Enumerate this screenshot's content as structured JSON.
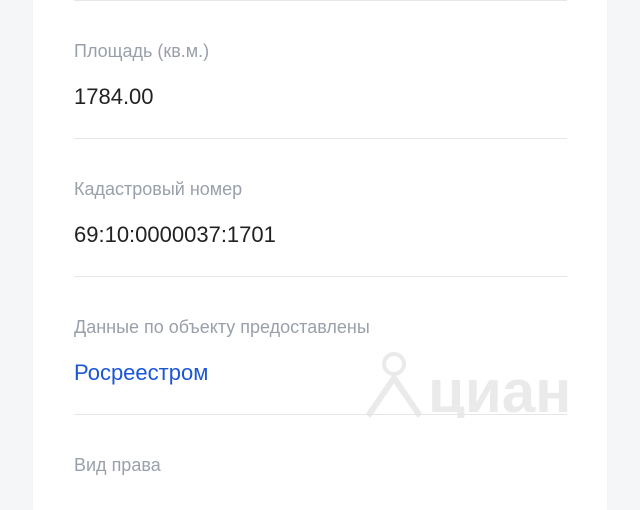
{
  "fields": [
    {
      "label": "Площадь (кв.м.)",
      "value": "1784.00"
    },
    {
      "label": "Кадастровый номер",
      "value": "69:10:0000037:1701"
    },
    {
      "label": "Данные по объекту предоставлены",
      "value": "Росреестром"
    },
    {
      "label": "Вид права"
    }
  ],
  "watermark": {
    "brand": "циан"
  },
  "colors": {
    "label": "#9aa0aa",
    "value": "#222222",
    "link": "#1b56d6",
    "divider": "#e4e6ea",
    "background": "#f5f6f8",
    "card": "#ffffff"
  }
}
